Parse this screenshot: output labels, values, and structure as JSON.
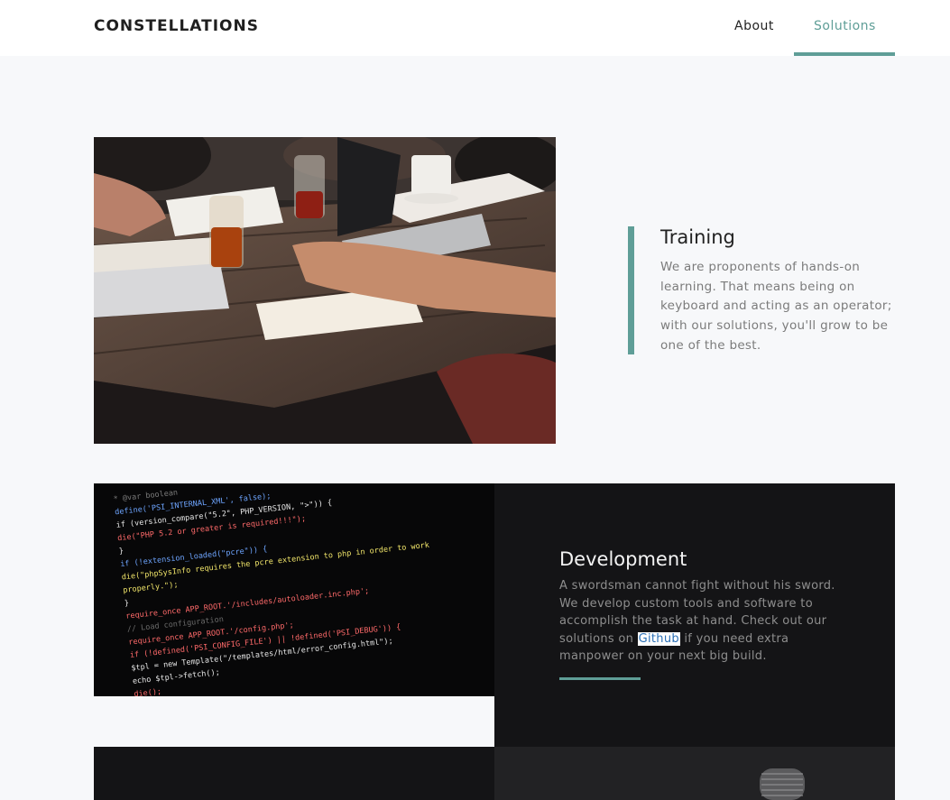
{
  "nav": {
    "brand": "CONSTELLATIONS",
    "links": [
      {
        "label": "About"
      },
      {
        "label": "Solutions",
        "active": true
      }
    ]
  },
  "training": {
    "title": "Training",
    "text": "We are proponents of hands-on learning. That means being on keyboard and acting as an operator; with our solutions, you'll grow to be one of the best."
  },
  "development": {
    "title": "Development",
    "text_before": "A swordsman cannot fight without his sword. We develop custom tools and software to accomplish the task at hand. Check out our solutions on",
    "link": "Github",
    "text_after": "if you need extra manpower on your next big build."
  },
  "code_lines": [
    "* @var boolean",
    "define('PSI_INTERNAL_XML', false);",
    "if (version_compare(\"5.2\", PHP_VERSION, \">\")) {",
    "    die(\"PHP 5.2 or greater is required!!!\");",
    "}",
    "if (!extension_loaded(\"pcre\")) {",
    "    die(\"phpSysInfo requires the pcre extension to php in order to work",
    "        properly.\");",
    "}",
    "require_once APP_ROOT.'/includes/autoloader.inc.php';",
    "// Load configuration",
    "require_once APP_ROOT.'/config.php';",
    "if (!defined('PSI_CONFIG_FILE') || !defined('PSI_DEBUG')) {",
    "    $tpl = new Template(\"/templates/html/error_config.html\");",
    "    echo $tpl->fetch();",
    "    die();"
  ],
  "colors": {
    "accent": "#5f9e97",
    "dark_panel": "#141416",
    "page_bg": "#f7f8fa"
  }
}
